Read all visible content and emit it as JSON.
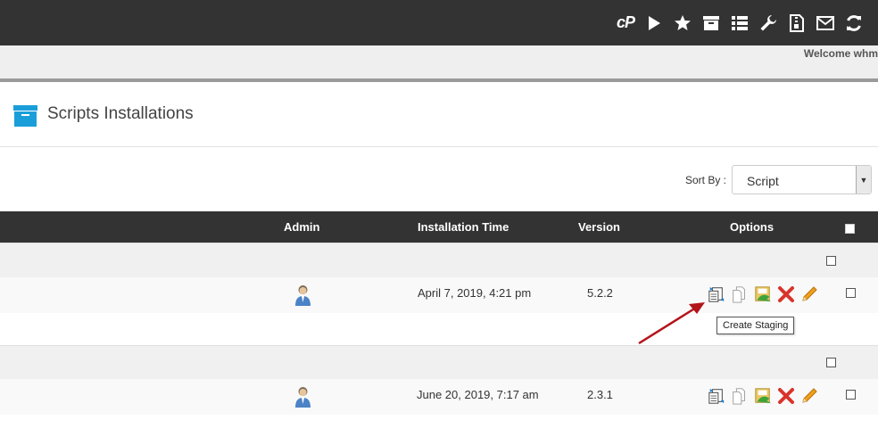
{
  "header": {
    "logo_text": "cP",
    "icons": [
      "cpanel-logo",
      "play-icon",
      "star-icon",
      "archive-icon",
      "list-icon",
      "wrench-icon",
      "zip-file-icon",
      "mail-icon",
      "refresh-icon"
    ]
  },
  "welcome_text": "Welcome whm",
  "page": {
    "title": "Scripts Installations",
    "icon": "archive-box-icon"
  },
  "sort": {
    "label": "Sort By :",
    "selected": "Script"
  },
  "table": {
    "columns": {
      "admin": "Admin",
      "install_time": "Installation Time",
      "version": "Version",
      "options": "Options"
    },
    "rows": [
      {
        "install_time": "April 7, 2019, 4:21 pm",
        "version": "5.2.2"
      },
      {
        "install_time": "June 20, 2019, 7:17 am",
        "version": "2.3.1"
      }
    ],
    "row_option_icons": [
      "create-staging-icon",
      "clone-icon",
      "backup-icon",
      "remove-icon",
      "edit-icon"
    ]
  },
  "tooltip": {
    "text": "Create Staging"
  },
  "colors": {
    "topbar": "#333333",
    "accent": "#1a9ed9",
    "remove": "#d9342b",
    "edit": "#f0a01e"
  }
}
